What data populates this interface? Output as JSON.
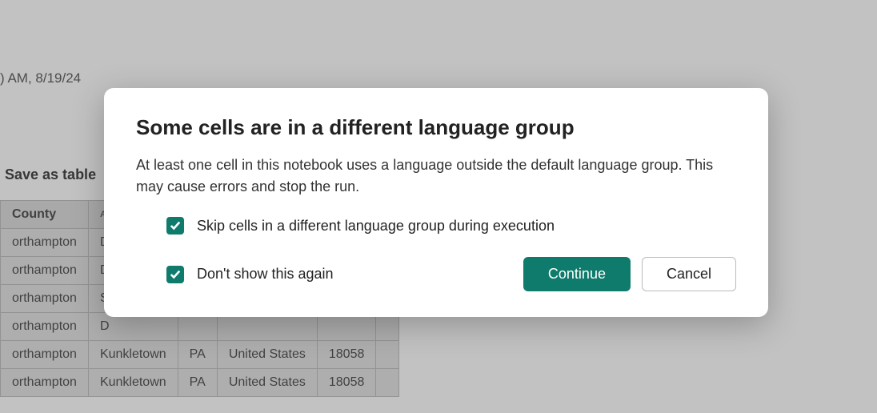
{
  "background": {
    "timestamp": ") AM, 8/19/24",
    "save_as_table": "Save as table",
    "table": {
      "headers": [
        "County",
        "A"
      ],
      "rows": [
        [
          "orthampton",
          "D",
          "",
          "",
          "",
          ""
        ],
        [
          "orthampton",
          "D",
          "",
          "",
          "",
          ""
        ],
        [
          "orthampton",
          "S",
          "",
          "",
          "",
          ""
        ],
        [
          "orthampton",
          "D",
          "",
          "",
          "",
          ""
        ],
        [
          "orthampton",
          "Kunkletown",
          "PA",
          "United States",
          "18058",
          ""
        ],
        [
          "orthampton",
          "Kunkletown",
          "PA",
          "United States",
          "18058",
          ""
        ]
      ]
    }
  },
  "dialog": {
    "title": "Some cells are in a different language group",
    "body": "At least one cell in this notebook uses a language outside the default language group. This may cause errors and stop the run.",
    "skip_checkbox_label": "Skip cells in a different language group during execution",
    "dont_show_label": "Don't show this again",
    "continue_label": "Continue",
    "cancel_label": "Cancel"
  }
}
